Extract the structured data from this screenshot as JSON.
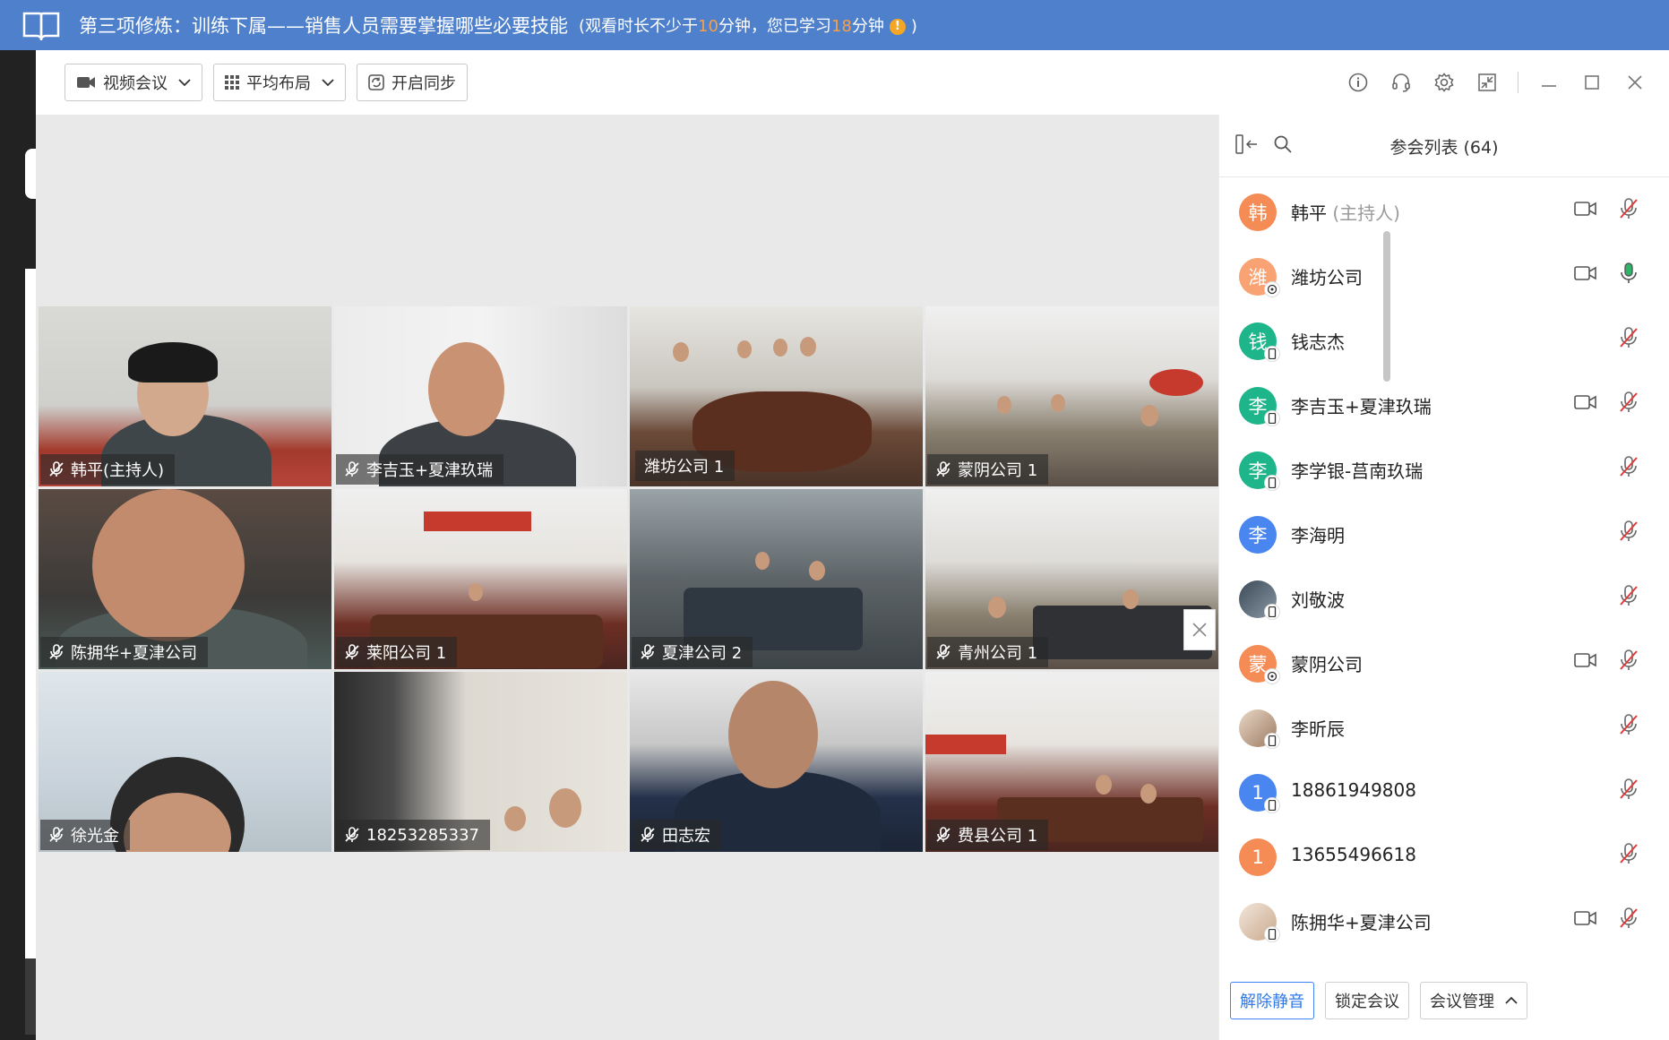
{
  "course": {
    "title": "第三项修炼：训练下属——销售人员需要掌握哪些必要技能",
    "note_prefix": "(观看时长不少于",
    "required_minutes": "10",
    "note_middle": "分钟，您已学习",
    "studied_minutes": "18",
    "note_suffix": "分钟",
    "note_end": ")"
  },
  "toolbar": {
    "video_meeting": "视频会议",
    "layout": "平均布局",
    "sync": "开启同步"
  },
  "tiles": [
    {
      "label": "韩平(主持人)"
    },
    {
      "label": "李吉玉+夏津玖瑞"
    },
    {
      "label": "潍坊公司 1"
    },
    {
      "label": "蒙阴公司 1"
    },
    {
      "label": "陈拥华+夏津公司"
    },
    {
      "label": "莱阳公司 1"
    },
    {
      "label": "夏津公司 2"
    },
    {
      "label": "青州公司 1"
    },
    {
      "label": "徐光金"
    },
    {
      "label": "18253285337"
    },
    {
      "label": "田志宏"
    },
    {
      "label": "费县公司 1"
    }
  ],
  "panel": {
    "title": "参会列表 (64)"
  },
  "participants": [
    {
      "avatar": "韩",
      "name": "韩平",
      "role": "(主持人)",
      "color": "#f58c56"
    },
    {
      "avatar": "潍",
      "name": "潍坊公司",
      "role": "",
      "color": "#f9a273"
    },
    {
      "avatar": "钱",
      "name": "钱志杰",
      "role": "",
      "color": "#1fb58b"
    },
    {
      "avatar": "李",
      "name": "李吉玉+夏津玖瑞",
      "role": "",
      "color": "#1fb58b"
    },
    {
      "avatar": "李",
      "name": "李学银-莒南玖瑞",
      "role": "",
      "color": "#1fb58b"
    },
    {
      "avatar": "李",
      "name": "李海明",
      "role": "",
      "color": "#4a86f0"
    },
    {
      "avatar": "",
      "name": "刘敬波",
      "role": "",
      "color": "#55606b"
    },
    {
      "avatar": "蒙",
      "name": "蒙阴公司",
      "role": "",
      "color": "#f58c56"
    },
    {
      "avatar": "",
      "name": "李昕辰",
      "role": "",
      "color": "#c8a890"
    },
    {
      "avatar": "1",
      "name": "18861949808",
      "role": "",
      "color": "#4a86f0"
    },
    {
      "avatar": "1",
      "name": "13655496618",
      "role": "",
      "color": "#f58c56"
    },
    {
      "avatar": "",
      "name": "陈拥华+夏津公司",
      "role": "",
      "color": "#d6c2b0"
    }
  ],
  "footer": {
    "unmute": "解除静音",
    "lock": "锁定会议",
    "manage": "会议管理"
  }
}
